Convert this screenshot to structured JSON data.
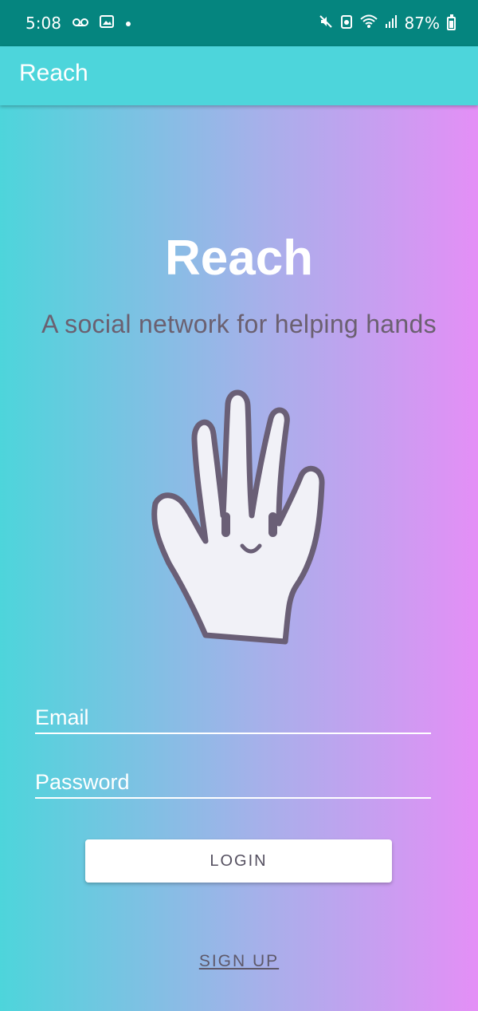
{
  "status_bar": {
    "time": "5:08",
    "battery_percent": "87%",
    "left_icons": [
      "voicemail-icon",
      "photo-notification-icon",
      "dot-icon"
    ],
    "right_icons": [
      "mute-icon",
      "data-saver-icon",
      "wifi-icon",
      "signal-icon",
      "battery-icon"
    ]
  },
  "app_bar": {
    "title": "Reach"
  },
  "hero": {
    "title": "Reach",
    "subtitle": "A social network for helping hands",
    "illustration": "waving-hand-icon"
  },
  "form": {
    "email_placeholder": "Email",
    "password_placeholder": "Password",
    "login_label": "LOGIN",
    "signup_label": "SIGN UP"
  },
  "colors": {
    "status_bar": "#05857f",
    "app_bar": "#4dd5db",
    "gradient_start": "#4dd5db",
    "gradient_end": "#e48ff6"
  }
}
